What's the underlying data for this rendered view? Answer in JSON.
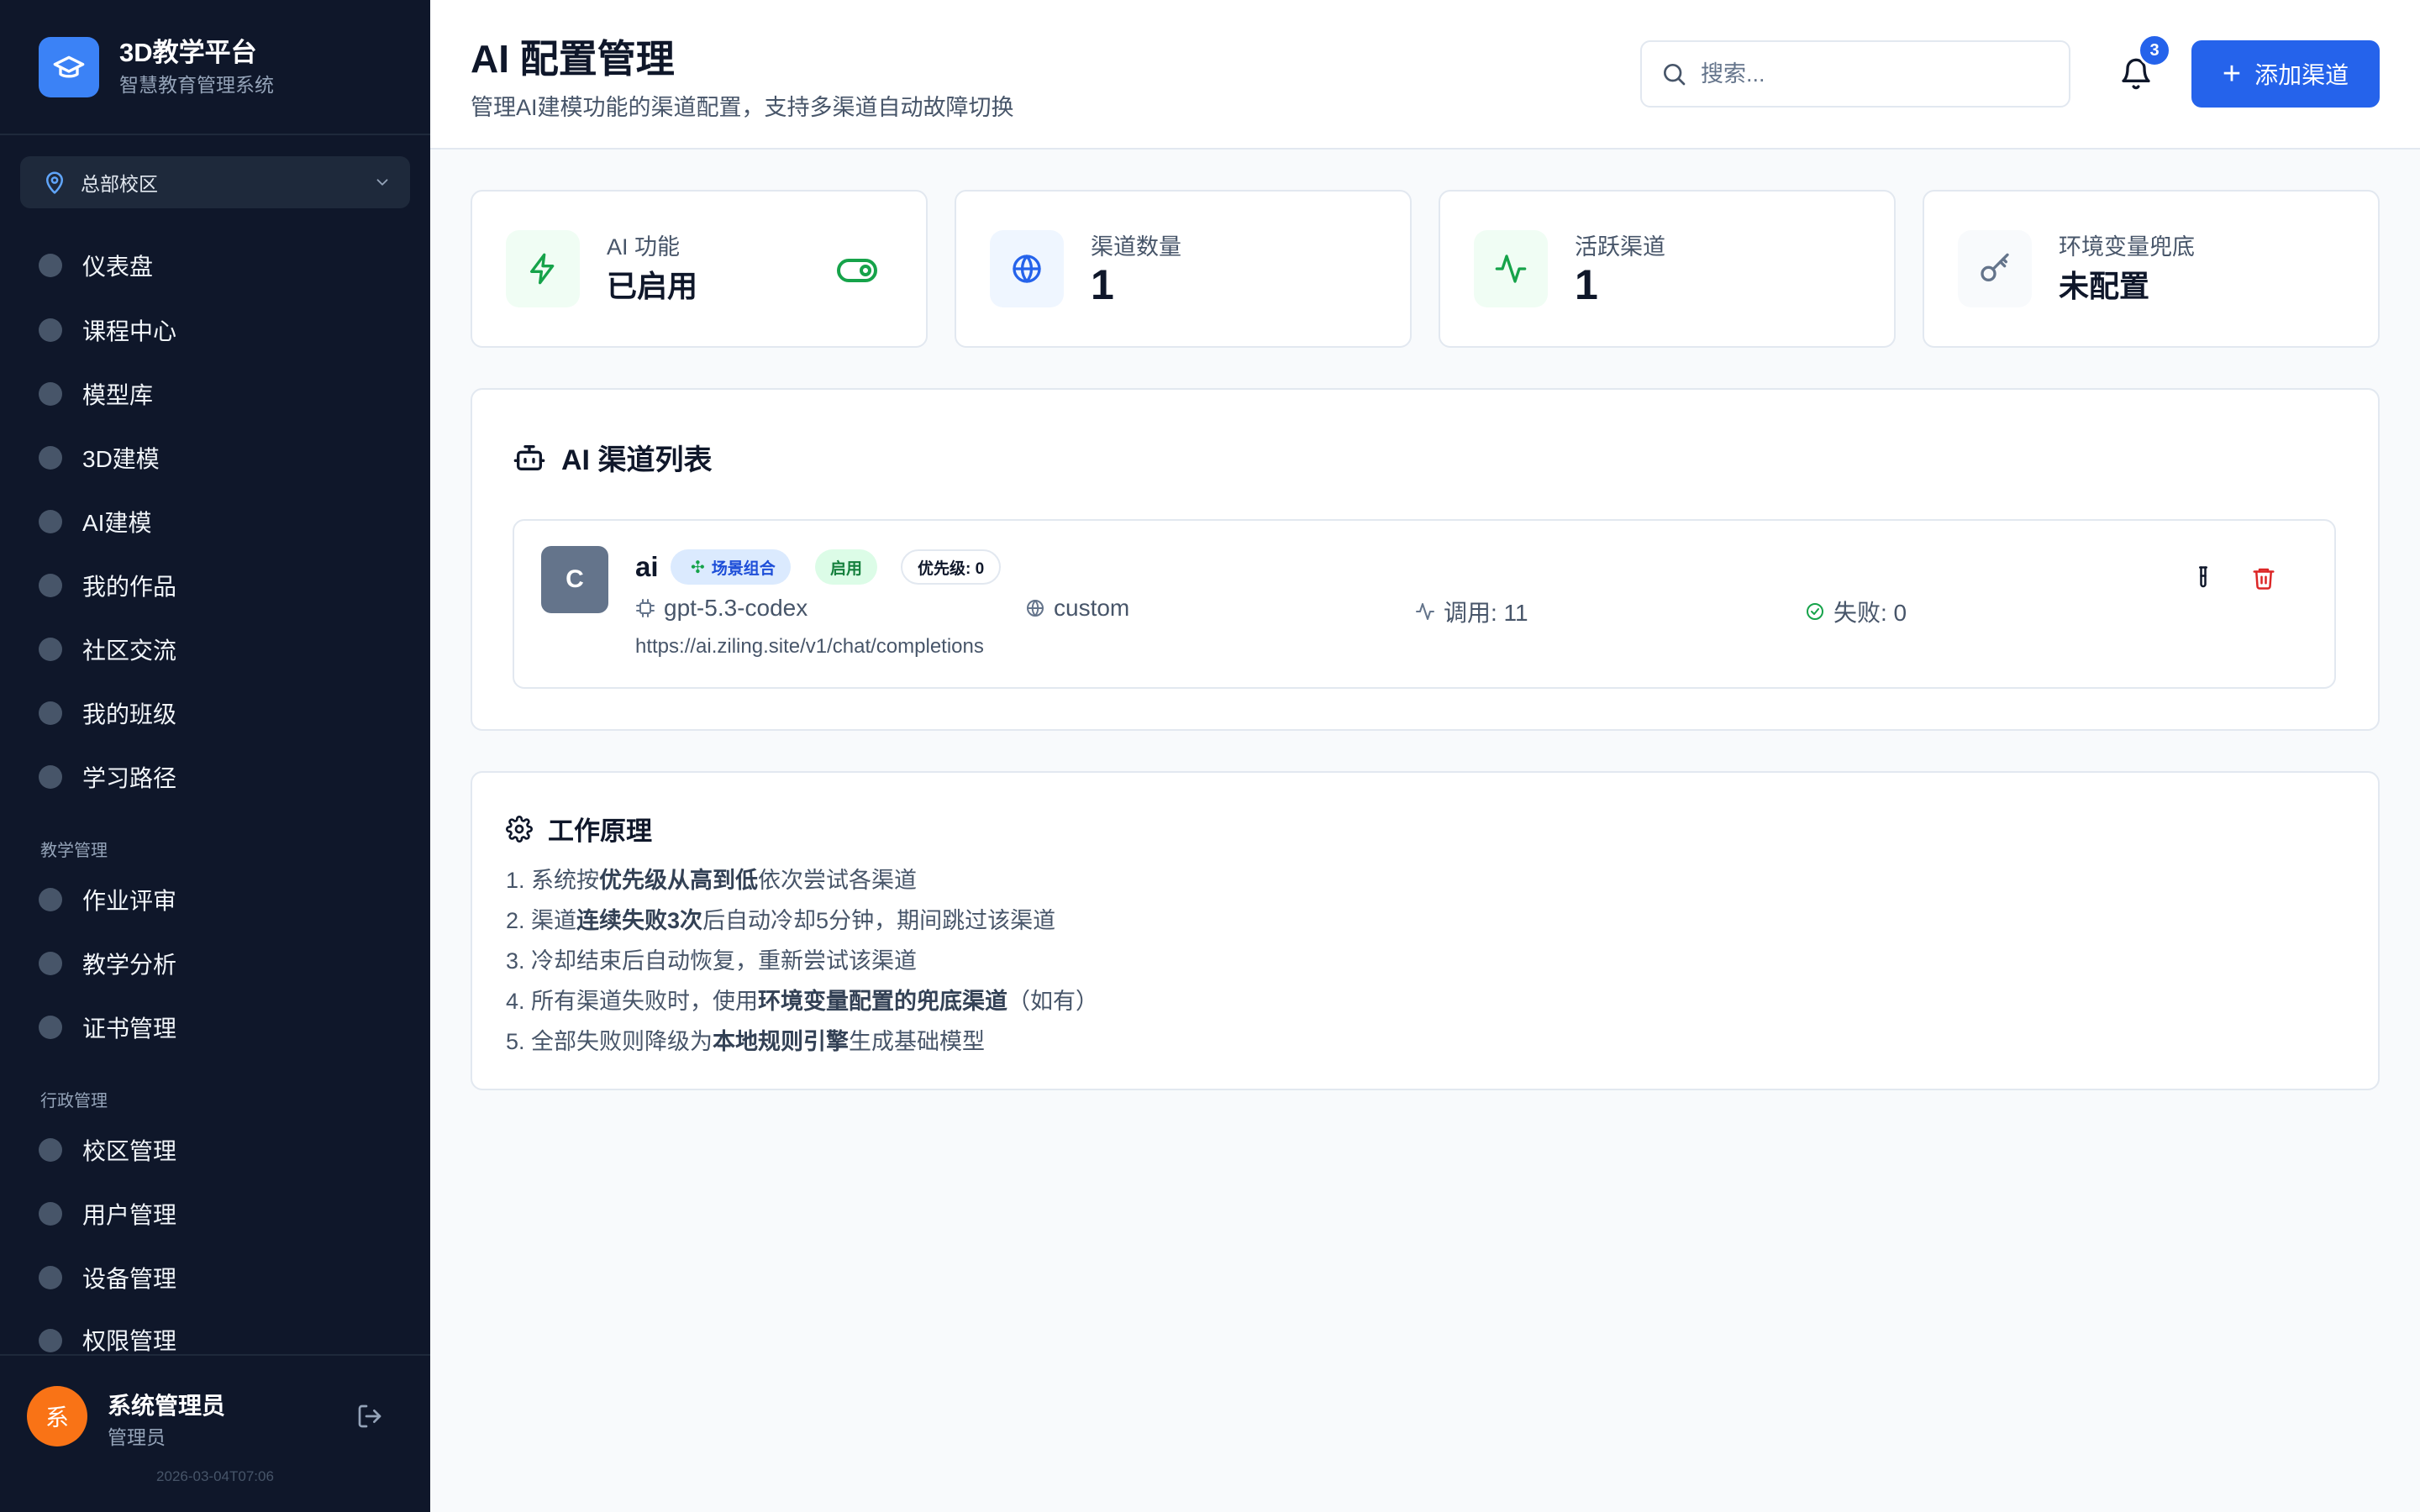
{
  "brand": {
    "title": "3D教学平台",
    "subtitle": "智慧教育管理系统"
  },
  "campus": {
    "label": "总部校区"
  },
  "nav": {
    "main": [
      "仪表盘",
      "课程中心",
      "模型库",
      "3D建模",
      "AI建模",
      "我的作品",
      "社区交流",
      "我的班级",
      "学习路径"
    ],
    "teaching_title": "教学管理",
    "teaching": [
      "作业评审",
      "教学分析",
      "证书管理"
    ],
    "admin_title": "行政管理",
    "admin": [
      "校区管理",
      "用户管理",
      "设备管理",
      "权限管理"
    ]
  },
  "user": {
    "avatar": "系",
    "name": "系统管理员",
    "role": "管理员",
    "timestamp": "2026-03-04T07:06"
  },
  "header": {
    "title": "AI 配置管理",
    "subtitle": "管理AI建模功能的渠道配置，支持多渠道自动故障切换",
    "search_placeholder": "搜索...",
    "notifications": "3",
    "add_label": "添加渠道"
  },
  "stats": [
    {
      "label": "AI 功能",
      "value": "已启用",
      "icon": "bolt-icon",
      "enabled": true
    },
    {
      "label": "渠道数量",
      "value": "1",
      "icon": "globe-icon"
    },
    {
      "label": "活跃渠道",
      "value": "1",
      "icon": "activity-icon"
    },
    {
      "label": "环境变量兜底",
      "value": "未配置",
      "icon": "key-icon"
    }
  ],
  "channels_panel": {
    "title": "AI 渠道列表",
    "channels": [
      {
        "avatar": "C",
        "name": "ai",
        "badge_scene": "场景组合",
        "badge_status": "启用",
        "badge_priority": "优先级: 0",
        "model": "gpt-5.3-codex",
        "type": "custom",
        "calls": "调用: 11",
        "failures": "失败: 0",
        "url": "https://ai.ziling.site/v1/chat/completions"
      }
    ]
  },
  "principle": {
    "title": "工作原理",
    "rules": [
      [
        "1. 系统按",
        "优先级从高到低",
        "依次尝试各渠道"
      ],
      [
        "2. 渠道",
        "连续失败3次",
        "后自动冷却5分钟，期间跳过该渠道"
      ],
      [
        "3. 冷却结束后自动恢复，重新尝试该渠道",
        "",
        ""
      ],
      [
        "4. 所有渠道失败时，使用",
        "环境变量配置的兜底渠道",
        "（如有）"
      ],
      [
        "5. 全部失败则降级为",
        "本地规则引擎",
        "生成基础模型"
      ]
    ]
  },
  "colors": {
    "primary": "#2563eb",
    "sidebar": "#0f172a",
    "success": "#16a34a",
    "danger": "#dc2626",
    "brand_logo": "#3b82f6",
    "avatar": "#f97316"
  }
}
